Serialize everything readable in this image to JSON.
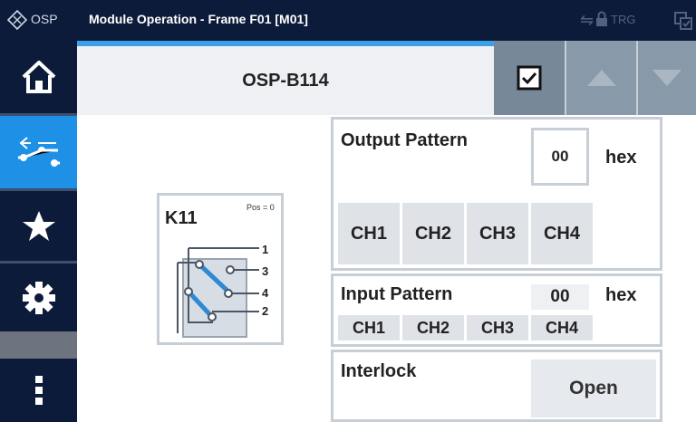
{
  "titlebar": {
    "logo_text": "OSP",
    "window_title": "Module Operation - Frame F01 [M01]",
    "trg_label": "TRG"
  },
  "sidebar": {
    "items": [
      {
        "name": "home-icon",
        "active": false
      },
      {
        "name": "switch-icon",
        "active": true
      },
      {
        "name": "star-icon",
        "active": false
      },
      {
        "name": "gear-icon",
        "active": false
      },
      {
        "name": "more-icon",
        "active": false
      }
    ]
  },
  "header": {
    "module_title": "OSP-B114"
  },
  "relay": {
    "name": "K11",
    "position": "Pos = 0",
    "ports": [
      "1",
      "3",
      "4",
      "2"
    ]
  },
  "output_pattern": {
    "title": "Output Pattern",
    "value": "00",
    "unit": "hex",
    "channels": [
      "CH1",
      "CH2",
      "CH3",
      "CH4"
    ]
  },
  "input_pattern": {
    "title": "Input Pattern",
    "value": "00",
    "unit": "hex",
    "channels": [
      "CH1",
      "CH2",
      "CH3",
      "CH4"
    ]
  },
  "interlock": {
    "title": "Interlock",
    "state": "Open"
  },
  "colors": {
    "navy": "#0d1b3a",
    "accent_blue": "#1e90e6",
    "slate_button": "#8899aa",
    "panel_border": "#c8ced6"
  }
}
